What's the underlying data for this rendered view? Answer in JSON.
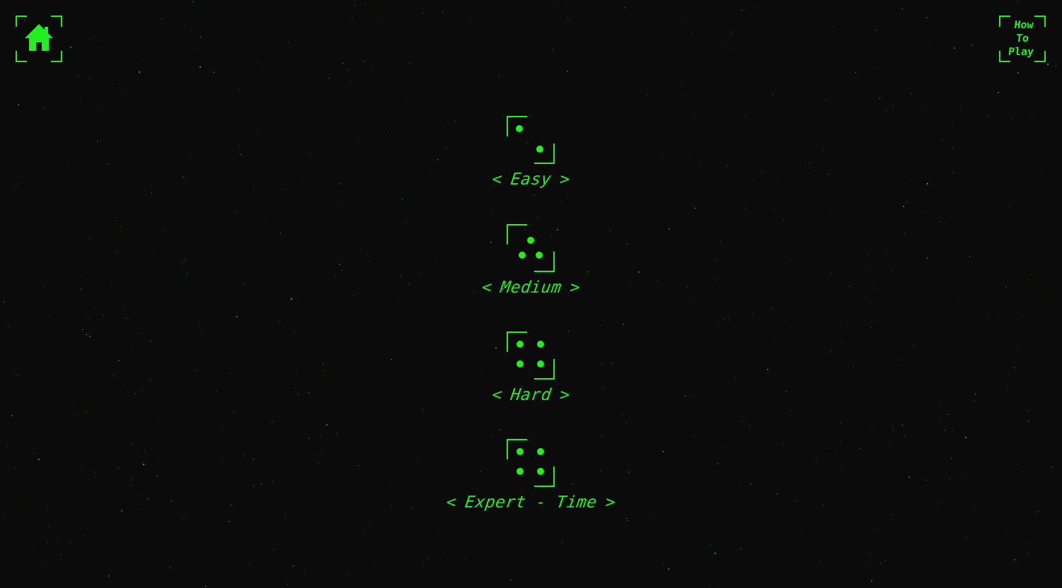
{
  "colors": {
    "background": "#0a0b0a",
    "accent": "#22ee22",
    "star": "#1a8a1a"
  },
  "top_bar": {
    "home_icon": "home-icon",
    "how_to_play_label": "How\nTo\nPlay"
  },
  "levels": [
    {
      "label": "Easy",
      "pips": 2,
      "left_arrow": "<",
      "right_arrow": ">"
    },
    {
      "label": "Medium",
      "pips": 3,
      "left_arrow": "<",
      "right_arrow": ">"
    },
    {
      "label": "Hard",
      "pips": 4,
      "left_arrow": "<",
      "right_arrow": ">"
    },
    {
      "label": "Expert - Time",
      "pips": 4,
      "left_arrow": "<",
      "right_arrow": ">"
    }
  ]
}
